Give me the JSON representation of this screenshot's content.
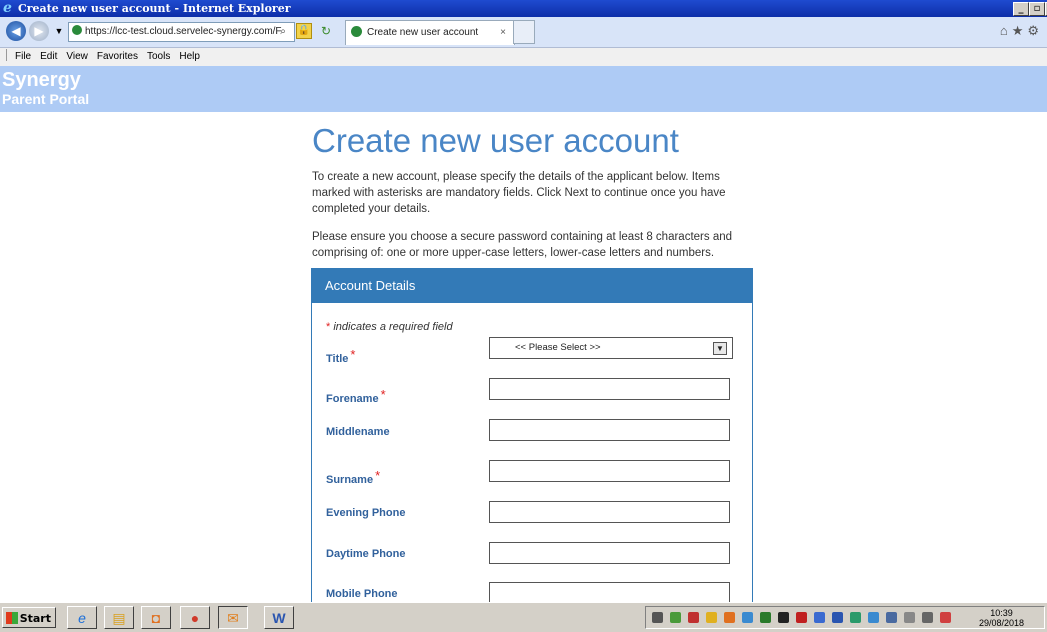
{
  "window": {
    "title": "Create new user account - Internet Explorer"
  },
  "browser": {
    "url": "https://lcc-test.cloud.servelec-synergy.com/F",
    "tab_title": "Create new user account",
    "tab_close": "×",
    "menu": [
      "File",
      "Edit",
      "View",
      "Favorites",
      "Tools",
      "Help"
    ]
  },
  "site": {
    "brand_line1": "Synergy",
    "brand_line2": "Parent Portal"
  },
  "page": {
    "title": "Create new user account",
    "intro": "To create a new account, please specify the details of the applicant below. Items marked with asterisks are mandatory fields. Click Next to continue once you have completed your details.",
    "password_note": "Please ensure you choose a secure password containing at least 8 characters and comprising of: one or more upper-case letters, lower-case letters and numbers."
  },
  "form": {
    "panel_title": "Account Details",
    "required_note": "indicates a required field",
    "required_marker": "*",
    "title_label": "Title",
    "title_value": "<< Please Select >>",
    "forename_label": "Forename",
    "middlename_label": "Middlename",
    "surname_label": "Surname",
    "evening_phone_label": "Evening Phone",
    "daytime_phone_label": "Daytime Phone",
    "mobile_phone_label": "Mobile Phone"
  },
  "taskbar": {
    "start_label": "Start",
    "time": "10:39",
    "date": "29/08/2018"
  }
}
